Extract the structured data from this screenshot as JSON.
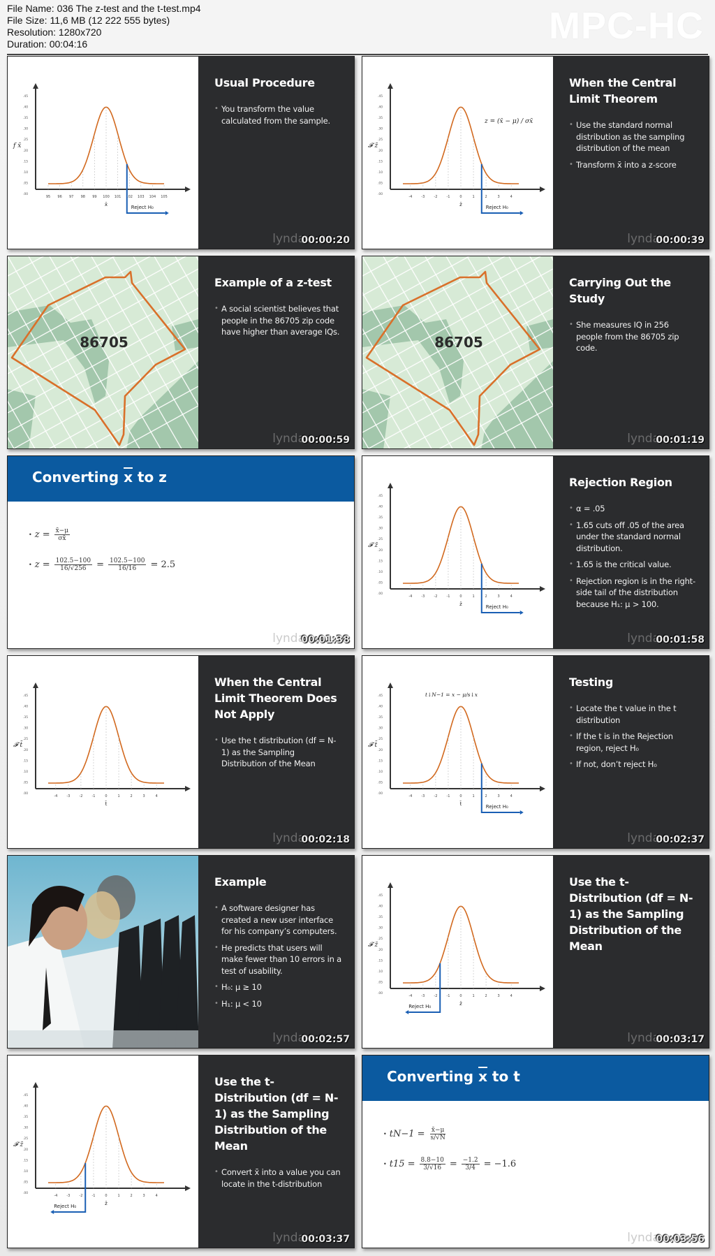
{
  "app": {
    "brand": "MPC-HC",
    "file_info": [
      "File Name: 036 The z-test and the t-test.mp4",
      "File Size: 11,6 MB (12 222 555 bytes)",
      "Resolution: 1280x720",
      "Duration: 00:04:16"
    ]
  },
  "watermark": "lynda",
  "colors": {
    "curve": "#d2691e",
    "reject": "#1a5fb4",
    "panel": "#2b2c2e",
    "band": "#0b5aa0",
    "map_light": "#d7ead6",
    "map_dark": "#a3c7ac",
    "map_border": "#d9702a"
  },
  "thumbnails": [
    {
      "timestamp": "00:00:20",
      "type": "chart",
      "title": "Usual Procedure",
      "bullets": [
        "You transform the value calculated from the sample."
      ],
      "chart": {
        "y_label": "f x̄",
        "x_label": "x̄",
        "y_ticks": [
          ".00",
          ".05",
          ".10",
          ".15",
          ".20",
          ".25",
          ".30",
          ".35",
          ".40",
          ".45"
        ],
        "x_ticks": [
          "95",
          "96",
          "97",
          "98",
          "99",
          "100",
          "101",
          "102",
          "103",
          "104",
          "105"
        ],
        "reject_label": "Reject H₀",
        "reject_side": "right",
        "formula": ""
      }
    },
    {
      "timestamp": "00:00:39",
      "type": "chart",
      "title": "When the Central Limit Theorem",
      "bullets": [
        "Use the standard normal distribution as the sampling distribution of the mean",
        "Transform x̄ into a z-score"
      ],
      "chart": {
        "y_label": "𝓕 z̄",
        "x_label": "z̄",
        "y_ticks": [
          ".00",
          ".05",
          ".10",
          ".15",
          ".20",
          ".25",
          ".30",
          ".35",
          ".40",
          ".45"
        ],
        "x_ticks": [
          "-4",
          "-3",
          "-2",
          "-1",
          "0",
          "1",
          "2",
          "3",
          "4"
        ],
        "reject_label": "Reject H₀",
        "reject_side": "right",
        "formula": "z = (x̄ − μ) / σx̄"
      }
    },
    {
      "timestamp": "00:00:59",
      "type": "map",
      "title": "Example of a z-test",
      "bullets": [
        "A social scientist believes that people in the 86705 zip code have higher than average IQs."
      ],
      "map_label": "86705"
    },
    {
      "timestamp": "00:01:19",
      "type": "map",
      "title": "Carrying Out the Study",
      "bullets": [
        "She measures IQ in 256 people from the 86705 zip code."
      ],
      "map_label": "86705"
    },
    {
      "timestamp": "00:01:38",
      "type": "band",
      "title_parts": [
        "Converting ",
        "x",
        " to z"
      ],
      "formulas": [
        {
          "lhs": "z =",
          "frac1_num": "x̄−μ",
          "frac1_den": "σx̄",
          "rest": ""
        },
        {
          "lhs": "z =",
          "frac1_num": "102.5−100",
          "frac1_den": "16/√256",
          "eq2": "=",
          "frac2_num": "102.5−100",
          "frac2_den": "16/16",
          "rest": "= 2.5"
        }
      ]
    },
    {
      "timestamp": "00:01:58",
      "type": "chart",
      "title": "Rejection Region",
      "bullets": [
        "α = .05",
        "1.65 cuts off .05 of the area under the standard normal distribution.",
        "1.65 is the critical value.",
        "Rejection region is in the right-side tail of the distribution because H₁: μ > 100."
      ],
      "chart": {
        "y_label": "𝓕 z̄",
        "x_label": "z̄",
        "y_ticks": [
          ".00",
          ".05",
          ".10",
          ".15",
          ".20",
          ".25",
          ".30",
          ".35",
          ".40",
          ".45"
        ],
        "x_ticks": [
          "-4",
          "-3",
          "-2",
          "-1",
          "0",
          "1",
          "2",
          "3",
          "4"
        ],
        "reject_label": "Reject H₀",
        "reject_side": "right",
        "formula": ""
      }
    },
    {
      "timestamp": "00:02:18",
      "type": "chart",
      "title": "When the Central Limit Theorem Does Not Apply",
      "bullets": [
        "Use the t distribution (df = N-1) as the Sampling Distribution of the Mean"
      ],
      "chart": {
        "y_label": "𝓕 t̄",
        "x_label": "t̄",
        "y_ticks": [
          ".00",
          ".05",
          ".10",
          ".15",
          ".20",
          ".25",
          ".30",
          ".35",
          ".40",
          ".45"
        ],
        "x_ticks": [
          "-4",
          "-3",
          "-2",
          "-1",
          "0",
          "1",
          "2",
          "3",
          "4"
        ],
        "reject_label": "",
        "reject_side": "none",
        "formula": ""
      }
    },
    {
      "timestamp": "00:02:37",
      "type": "chart",
      "title": "Testing",
      "bullets": [
        "Locate the t value in the t distribution",
        "If the t is in the Rejection region, reject H₀",
        "If not, don’t reject H₀"
      ],
      "chart": {
        "y_label": "𝓕 t̄",
        "x_label": "t̄",
        "y_ticks": [
          ".00",
          ".05",
          ".10",
          ".15",
          ".20",
          ".25",
          ".30",
          ".35",
          ".40",
          ".45"
        ],
        "x_ticks": [
          "-4",
          "-3",
          "-2",
          "-1",
          "0",
          "1",
          "2",
          "3",
          "4"
        ],
        "reject_label": "Reject H₀",
        "reject_side": "right",
        "formula": "t↓N−1 = x − μ/s↓x"
      }
    },
    {
      "timestamp": "00:02:57",
      "type": "photo",
      "title": "Example",
      "bullets": [
        "A software designer has created a new user interface for his company’s computers.",
        "He predicts that users will make fewer than 10 errors in a test of usability.",
        "H₀: μ ≥ 10",
        "H₁: μ < 10"
      ]
    },
    {
      "timestamp": "00:03:17",
      "type": "chart",
      "title": "Use the t-Distribution (df = N-1) as the Sampling Distribution of the Mean",
      "bullets": [],
      "chart": {
        "y_label": "𝓕 z̄",
        "x_label": "z̄",
        "y_ticks": [
          ".00",
          ".05",
          ".10",
          ".15",
          ".20",
          ".25",
          ".30",
          ".35",
          ".40",
          ".45"
        ],
        "x_ticks": [
          "-4",
          "-3",
          "-2",
          "-1",
          "0",
          "1",
          "2",
          "3",
          "4"
        ],
        "reject_label": "Reject H₀",
        "reject_side": "left",
        "formula": ""
      }
    },
    {
      "timestamp": "00:03:37",
      "type": "chart",
      "title": "Use the t-Distribution (df = N-1) as the Sampling Distribution of the Mean",
      "bullets": [
        "Convert x̄ into a value you can locate in the t-distribution"
      ],
      "chart": {
        "y_label": "𝓕 z̄",
        "x_label": "z̄",
        "y_ticks": [
          ".00",
          ".05",
          ".10",
          ".15",
          ".20",
          ".25",
          ".30",
          ".35",
          ".40",
          ".45"
        ],
        "x_ticks": [
          "-4",
          "-3",
          "-2",
          "-1",
          "0",
          "1",
          "2",
          "3",
          "4"
        ],
        "reject_label": "Reject H₀",
        "reject_side": "left",
        "formula": ""
      }
    },
    {
      "timestamp": "00:03:56",
      "type": "band",
      "title_parts": [
        "Converting ",
        "x",
        " to t"
      ],
      "formulas": [
        {
          "lhs": "tN−1 =",
          "frac1_num": "x̄−μ",
          "frac1_den": "s/√N",
          "rest": ""
        },
        {
          "lhs": "t15 =",
          "frac1_num": "8.8−10",
          "frac1_den": "3/√16",
          "eq2": "=",
          "frac2_num": "−1.2",
          "frac2_den": "3/4",
          "rest": "= −1.6"
        }
      ]
    }
  ]
}
